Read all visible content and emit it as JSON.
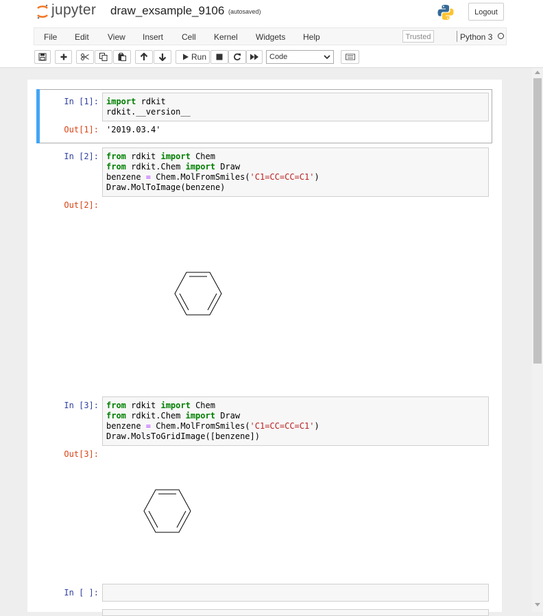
{
  "header": {
    "logo_text": "jupyter",
    "notebook_title": "draw_exsample_9106",
    "autosave_status": "(autosaved)",
    "logout_label": "Logout"
  },
  "menu": {
    "items": [
      "File",
      "Edit",
      "View",
      "Insert",
      "Cell",
      "Kernel",
      "Widgets",
      "Help"
    ],
    "trusted_label": "Trusted",
    "kernel_name": "Python 3"
  },
  "toolbar": {
    "icons": [
      "save-icon",
      "plus-icon",
      "cut-icon",
      "copy-icon",
      "paste-icon",
      "arrow-up-icon",
      "arrow-down-icon",
      "play-icon",
      "stop-icon",
      "restart-icon",
      "fast-forward-icon",
      "keyboard-icon"
    ],
    "run_label": "Run",
    "cell_type": "Code"
  },
  "cells": [
    {
      "in_prompt": "In [1]:",
      "code": [
        "import rdkit",
        "rdkit.__version__"
      ],
      "out_prompt": "Out[1]:",
      "output": "'2019.03.4'"
    },
    {
      "in_prompt": "In [2]:",
      "code": [
        "from rdkit import Chem",
        "from rdkit.Chem import Draw",
        "benzene = Chem.MolFromSmiles('C1=CC=CC=C1')",
        "Draw.MolToImage(benzene)"
      ],
      "out_prompt": "Out[2]:",
      "output_image": "benzene-structure"
    },
    {
      "in_prompt": "In [3]:",
      "code": [
        "from rdkit import Chem",
        "from rdkit.Chem import Draw",
        "benzene = Chem.MolFromSmiles('C1=CC=CC=C1')",
        "Draw.MolsToGridImage([benzene])"
      ],
      "out_prompt": "Out[3]:",
      "output_image": "benzene-structure"
    },
    {
      "in_prompt": "In [ ]:",
      "code": []
    }
  ],
  "colors": {
    "selected_bar": "#42a5f5",
    "prompt_in": "#303f9f",
    "prompt_out": "#d84315",
    "keyword": "#008000",
    "string": "#ba2121"
  }
}
